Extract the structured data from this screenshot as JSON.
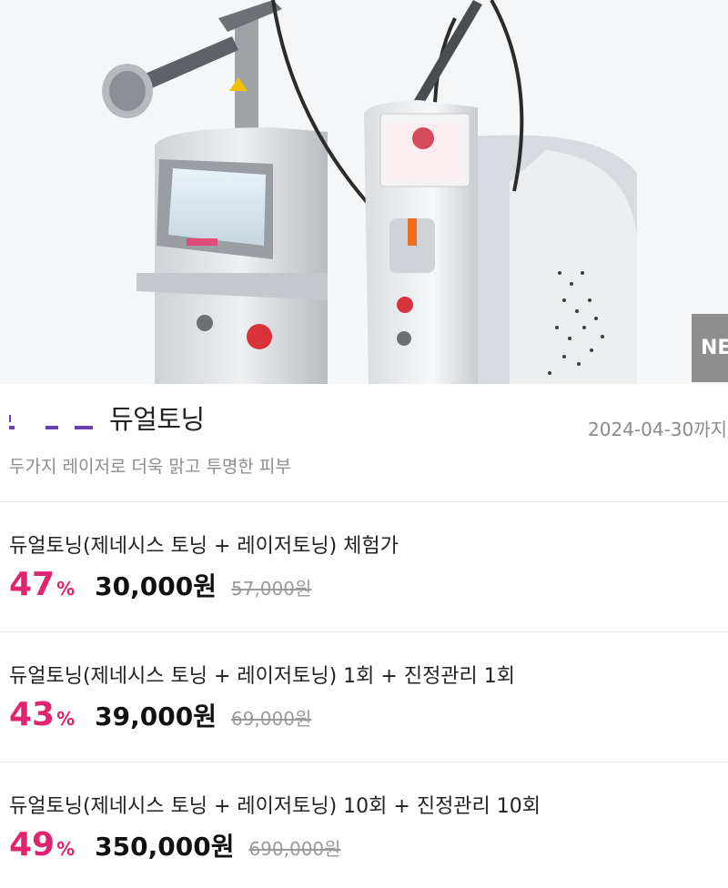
{
  "hero": {
    "image": "dual-laser-machine-photo",
    "badge": "NE"
  },
  "product": {
    "title": "듀얼토닝",
    "period": "2024-04-30까지",
    "subtitle": "두가지 레이저로 더욱 맑고 투명한 피부",
    "brand_color": "#6a3fb5"
  },
  "options": [
    {
      "name": "듀얼토닝(제네시스 토닝 + 레이저토닝) 체험가",
      "discount": "47",
      "pct_sign": "%",
      "price": "30,000원",
      "original": "57,000원"
    },
    {
      "name": "듀얼토닝(제네시스 토닝 + 레이저토닝) 1회 + 진정관리 1회",
      "discount": "43",
      "pct_sign": "%",
      "price": "39,000원",
      "original": "69,000원"
    },
    {
      "name": "듀얼토닝(제네시스 토닝 + 레이저토닝) 10회 + 진정관리 10회",
      "discount": "49",
      "pct_sign": "%",
      "price": "350,000원",
      "original": "690,000원"
    }
  ],
  "colors": {
    "discount": "#e0246f",
    "price": "#111111",
    "original": "#9a9a9a"
  }
}
